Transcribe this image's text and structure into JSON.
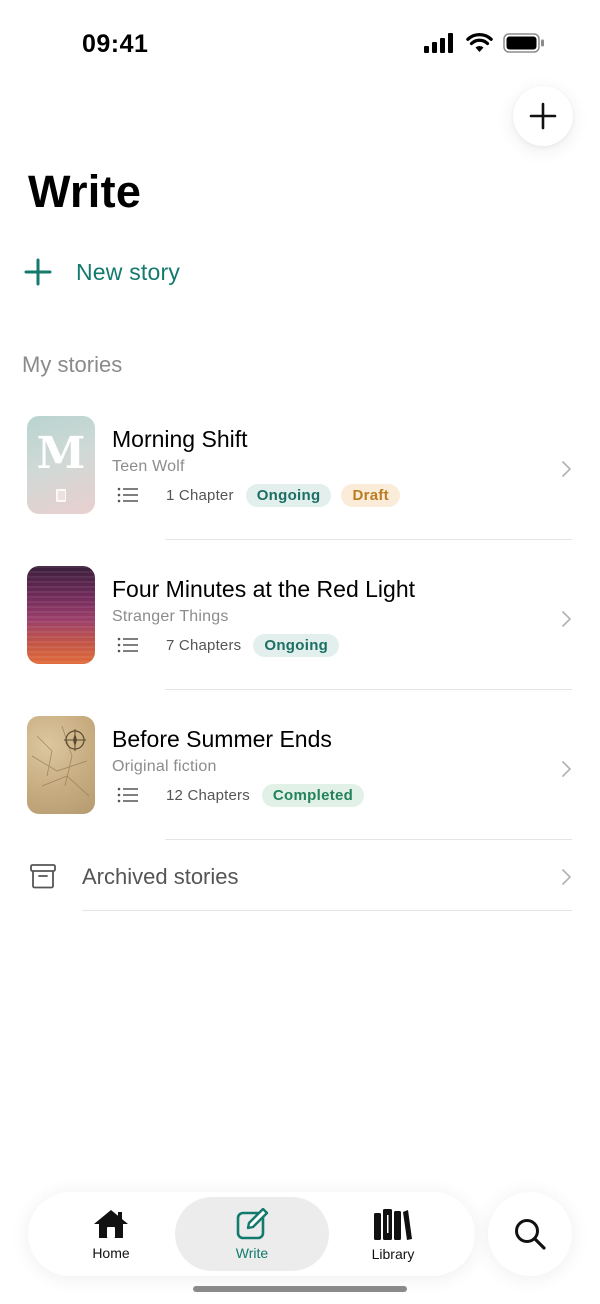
{
  "status_bar": {
    "time": "09:41"
  },
  "header": {
    "title": "Write"
  },
  "actions": {
    "new_story_label": "New story"
  },
  "sections": {
    "my_stories": "My stories"
  },
  "stories": [
    {
      "title": "Morning Shift",
      "fandom": "Teen Wolf",
      "chapters": "1 Chapter",
      "badges": [
        "Ongoing",
        "Draft"
      ],
      "cover_letter": "M"
    },
    {
      "title": "Four Minutes at the Red Light",
      "fandom": "Stranger Things",
      "chapters": "7 Chapters",
      "badges": [
        "Ongoing"
      ]
    },
    {
      "title": "Before Summer Ends",
      "fandom": "Original fiction",
      "chapters": "12 Chapters",
      "badges": [
        "Completed"
      ]
    }
  ],
  "archived": {
    "label": "Archived stories"
  },
  "tabs": [
    {
      "label": "Home",
      "icon": "home-icon"
    },
    {
      "label": "Write",
      "icon": "compose-icon",
      "active": true
    },
    {
      "label": "Library",
      "icon": "library-icon"
    }
  ],
  "colors": {
    "accent": "#137a6d",
    "ongoing_bg": "#e2efed",
    "draft_bg": "#fbebd9",
    "completed_bg": "#e1f1e8"
  }
}
